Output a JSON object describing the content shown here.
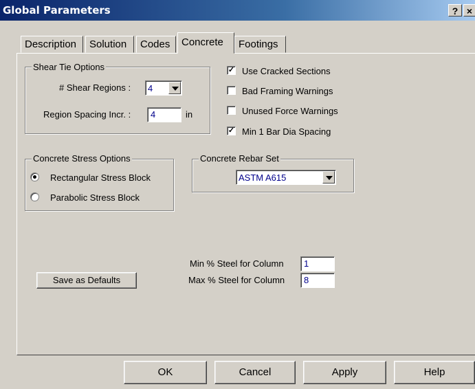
{
  "window": {
    "title": "Global Parameters",
    "help_glyph": "?",
    "close_glyph": "×"
  },
  "tabs": [
    {
      "label": "Description"
    },
    {
      "label": "Solution"
    },
    {
      "label": "Codes"
    },
    {
      "label": "Concrete",
      "active": true
    },
    {
      "label": "Footings"
    }
  ],
  "shear_tie": {
    "group_label": "Shear Tie Options",
    "regions_label": "# Shear Regions :",
    "regions_value": "4",
    "spacing_label": "Region Spacing Incr. :",
    "spacing_value": "4",
    "spacing_unit": "in"
  },
  "checkboxes": [
    {
      "label": "Use Cracked Sections",
      "checked": true
    },
    {
      "label": "Bad Framing Warnings",
      "checked": false
    },
    {
      "label": "Unused Force Warnings",
      "checked": false
    },
    {
      "label": "Min 1 Bar Dia Spacing",
      "checked": true
    }
  ],
  "check_mark": "✓",
  "stress": {
    "group_label": "Concrete Stress Options",
    "options": [
      {
        "label": "Rectangular Stress Block",
        "selected": true
      },
      {
        "label": "Parabolic Stress Block",
        "selected": false
      }
    ]
  },
  "rebar": {
    "group_label": "Concrete Rebar Set",
    "value": "ASTM A615"
  },
  "steel": {
    "min_label": "Min % Steel for Column",
    "min_value": "1",
    "max_label": "Max % Steel for Column",
    "max_value": "8"
  },
  "save_defaults_label": "Save as Defaults",
  "buttons": {
    "ok": "OK",
    "cancel": "Cancel",
    "apply": "Apply",
    "help": "Help"
  },
  "colors": {
    "face": "#d4d0c8",
    "title_start": "#0a246a",
    "title_end": "#a6caf0",
    "value_text": "#00008b"
  }
}
